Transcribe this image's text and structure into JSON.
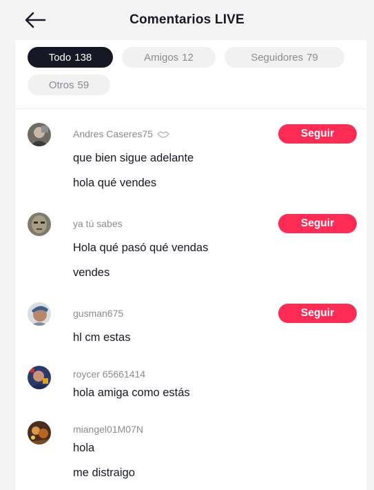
{
  "header": {
    "title": "Comentarios LIVE"
  },
  "filters": [
    {
      "label": "Todo",
      "count": "138",
      "active": true
    },
    {
      "label": "Amigos",
      "count": "12",
      "active": false
    },
    {
      "label": "Seguidores",
      "count": "79",
      "active": false
    },
    {
      "label": "Otros",
      "count": "59",
      "active": false
    }
  ],
  "comments": [
    {
      "username": "Andres Caseres75",
      "lines": [
        "que bien sigue adelante",
        "hola qué vendes"
      ],
      "follow_label": "Seguir",
      "badge_icon": "handshake-icon"
    },
    {
      "username": "ya tú sabes",
      "lines": [
        "Hola qué pasó qué vendas",
        "vendes"
      ],
      "follow_label": "Seguir"
    },
    {
      "username": "gusman675",
      "lines": [
        "hl cm estas"
      ],
      "follow_label": "Seguir"
    },
    {
      "username": "roycer 65661414",
      "lines": [
        "hola amiga como estás"
      ]
    },
    {
      "username": "miangel01M07N",
      "lines": [
        "hola",
        "me distraigo"
      ]
    }
  ],
  "colors": {
    "accent": "#fe2c55",
    "active_chip": "#161823",
    "chip_bg": "#f1f1f2",
    "muted_text": "#8a8b91"
  }
}
